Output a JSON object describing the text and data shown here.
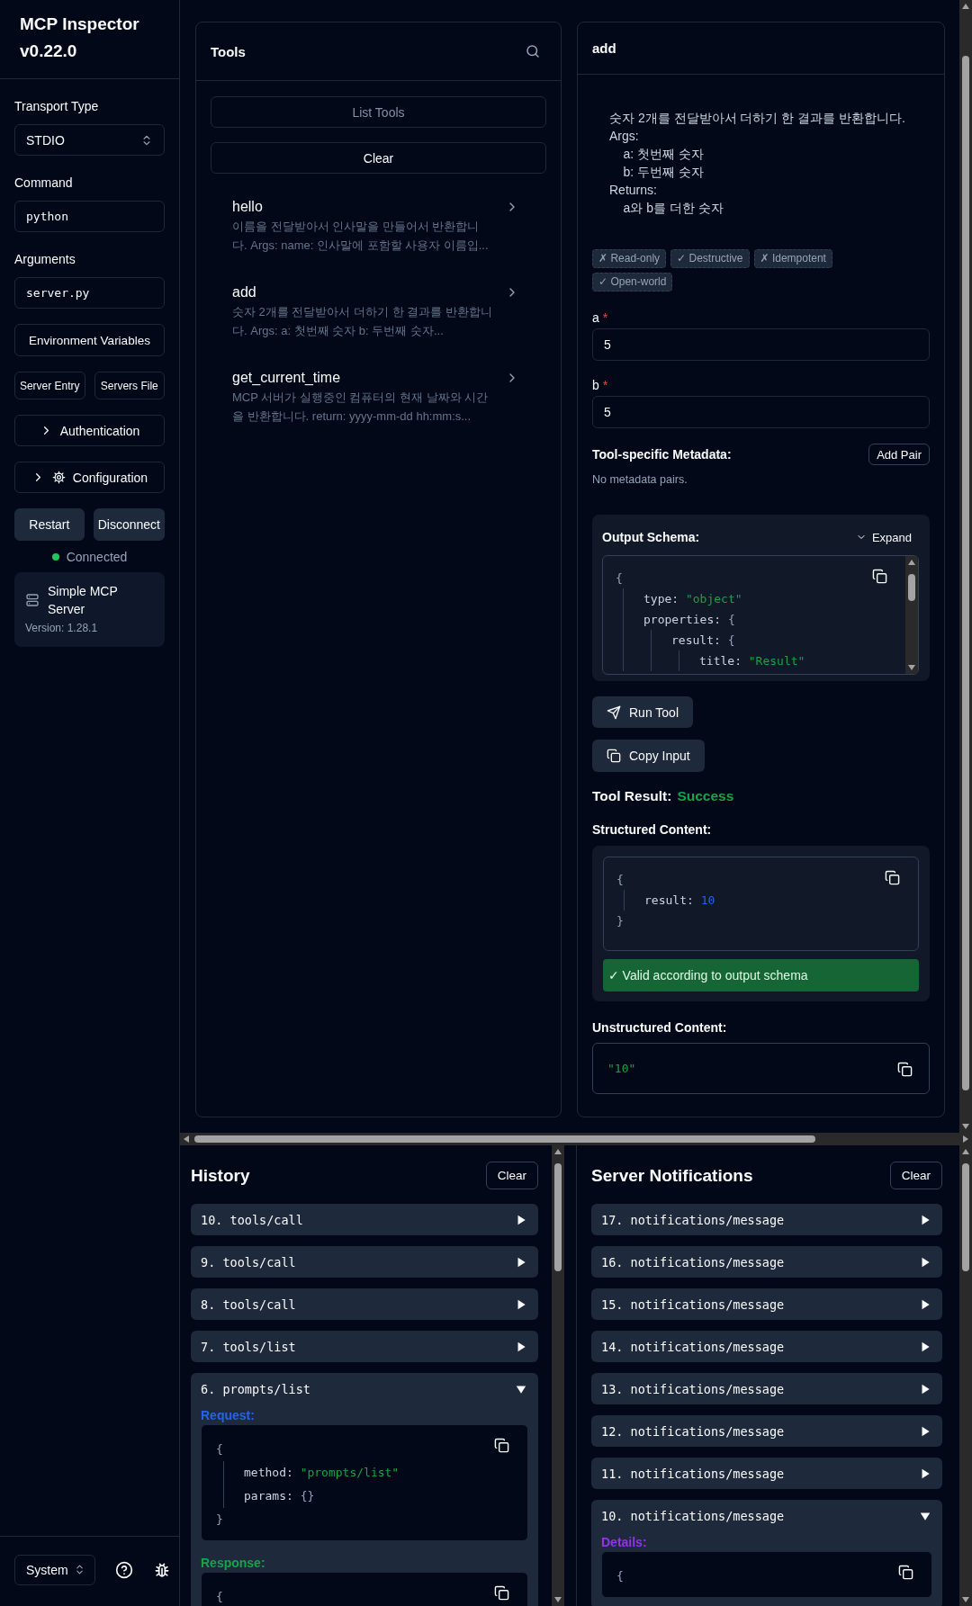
{
  "sidebar": {
    "title": "MCP Inspector v0.22.0",
    "fields": [
      {
        "label": "Transport Type",
        "kind": "select",
        "value": "STDIO"
      },
      {
        "label": "Command",
        "kind": "input",
        "value": "python"
      },
      {
        "label": "Arguments",
        "kind": "input",
        "value": "server.py"
      }
    ],
    "env_button": "Environment Variables",
    "file_buttons": [
      "Server Entry",
      "Servers File"
    ],
    "sections": [
      {
        "label": "Authentication",
        "kind": "plain",
        "expanded": false
      },
      {
        "label": "Configuration",
        "kind": "settings",
        "expanded": false
      }
    ],
    "actions": [
      "Restart",
      "Disconnect"
    ],
    "status": {
      "text": "Connected",
      "connected": true
    },
    "server": {
      "name": "Simple MCP Server",
      "version": "Version: 1.28.1"
    },
    "theme": "System"
  },
  "tools": {
    "title": "Tools",
    "list_button": {
      "label": "List Tools",
      "disabled": true
    },
    "clear_button": "Clear",
    "items": [
      {
        "name": "hello",
        "description": "이름을 전달받아서 인사말을 만들어서 반환합니다. Args: name: 인사말에 포함할 사용자 이름입..."
      },
      {
        "name": "add",
        "description": "숫자 2개를 전달받아서 더하기 한 결과를 반환합니다. Args: a: 첫번째 숫자 b: 두번째 숫자..."
      },
      {
        "name": "get_current_time",
        "description": "MCP 서버가 실행중인 컴퓨터의 현재 날짜와 시간을 반환합니다. return: yyyy-mm-dd hh:mm:s..."
      }
    ]
  },
  "detail": {
    "title": "add",
    "description": "숫자 2개를 전달받아서 더하기 한 결과를 반환합니다.\nArgs:\n    a: 첫번째 숫자\n    b: 두번째 숫자\nReturns:\n    a와 b를 더한 숫자",
    "annotations": [
      "✗ Read-only",
      "✓ Destructive",
      "✗ Idempotent",
      "✓ Open-world"
    ],
    "params": [
      {
        "name": "a",
        "required_mark": "*",
        "value": "5"
      },
      {
        "name": "b",
        "required_mark": "*",
        "value": "5"
      }
    ],
    "metadata": {
      "title": "Tool-specific Metadata:",
      "button": "Add Pair",
      "empty": "No metadata pairs."
    },
    "output_schema": {
      "title": "Output Schema:",
      "expand": "Expand",
      "expanded": false,
      "code": {
        "open": "{",
        "entries": [
          {
            "key": "type:",
            "value": "\"object\"",
            "kind": "string"
          },
          {
            "key": "properties:",
            "kind": "object",
            "open": "{",
            "entries": [
              {
                "key": "result:",
                "kind": "object",
                "open": "{",
                "entries": [
                  {
                    "key": "title:",
                    "value": "\"Result\"",
                    "kind": "string"
                  }
                ]
              }
            ]
          }
        ]
      }
    },
    "run_button": "Run Tool",
    "copy_button": "Copy Input",
    "result": {
      "label": "Tool Result:",
      "status": "Success",
      "kind": "success"
    },
    "structured": {
      "title": "Structured Content:",
      "code": {
        "open": "{",
        "entries": [
          {
            "key": "result:",
            "value": "10",
            "kind": "number"
          }
        ],
        "close": "}"
      },
      "validation": {
        "text": "✓ Valid according to output schema",
        "valid": true
      }
    },
    "unstructured": {
      "title": "Unstructured Content:",
      "value": "\"10\"",
      "kind": "string"
    }
  },
  "history": {
    "title": "History",
    "clear": "Clear",
    "items": [
      {
        "label": "10. tools/call",
        "expanded": false
      },
      {
        "label": "9. tools/call",
        "expanded": false
      },
      {
        "label": "8. tools/call",
        "expanded": false
      },
      {
        "label": "7. tools/list",
        "expanded": false
      },
      {
        "label": "6. prompts/list",
        "expanded": true,
        "sections": [
          {
            "title": "Request:",
            "kind": "request",
            "code": {
              "open": "{",
              "entries": [
                {
                  "key": "method:",
                  "value": "\"prompts/list\"",
                  "kind": "string"
                },
                {
                  "key": "params:",
                  "value": "{}",
                  "kind": "empty"
                }
              ],
              "close": "}"
            }
          },
          {
            "title": "Response:",
            "kind": "response",
            "code": {
              "open": "{"
            }
          }
        ]
      }
    ]
  },
  "notifications": {
    "title": "Server Notifications",
    "clear": "Clear",
    "items": [
      {
        "label": "17. notifications/message",
        "expanded": false
      },
      {
        "label": "16. notifications/message",
        "expanded": false
      },
      {
        "label": "15. notifications/message",
        "expanded": false
      },
      {
        "label": "14. notifications/message",
        "expanded": false
      },
      {
        "label": "13. notifications/message",
        "expanded": false
      },
      {
        "label": "12. notifications/message",
        "expanded": false
      },
      {
        "label": "11. notifications/message",
        "expanded": false
      },
      {
        "label": "10. notifications/message",
        "expanded": true,
        "sections": [
          {
            "title": "Details:",
            "kind": "details",
            "code": {
              "open": "{"
            }
          }
        ]
      }
    ]
  }
}
